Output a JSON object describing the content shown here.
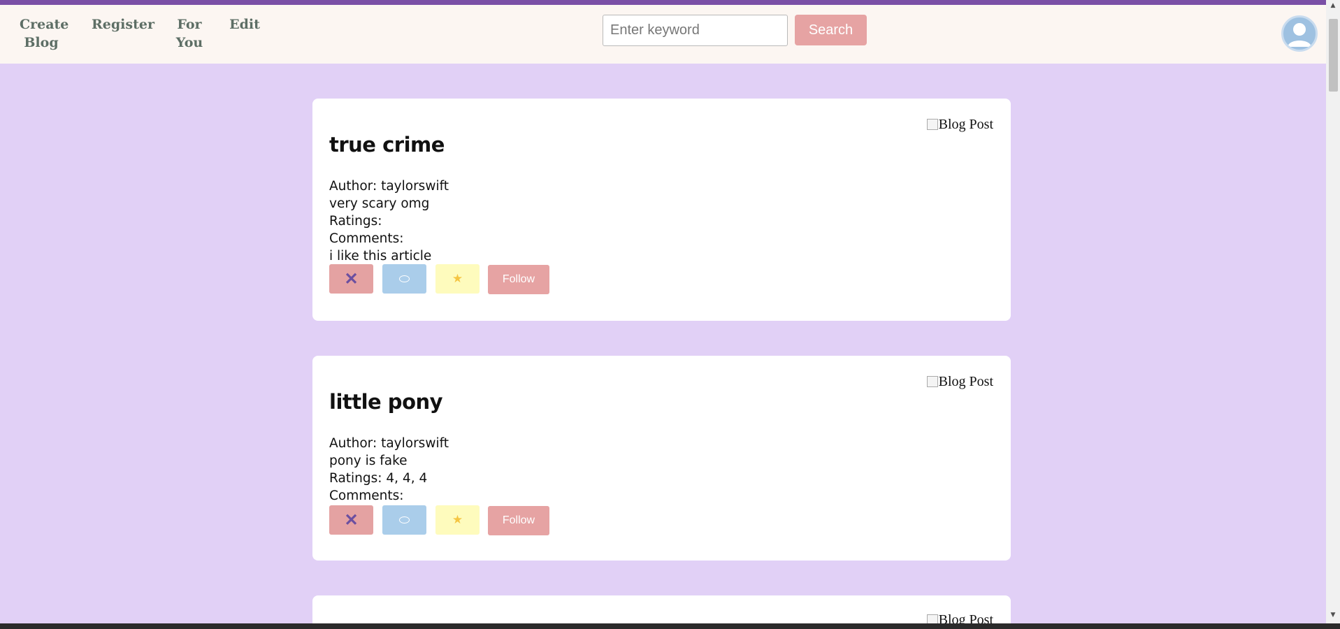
{
  "nav": {
    "create_blog": "Create Blog",
    "register": "Register",
    "for_you": "For You",
    "edit": "Edit"
  },
  "search": {
    "placeholder": "Enter keyword",
    "button_label": "Search"
  },
  "icons": {
    "close": "close-icon",
    "comment": "comment-icon",
    "star": "star-icon",
    "avatar": "user-avatar-icon"
  },
  "colors": {
    "page_bg": "#e1d0f6",
    "top_bar": "#7a4fa6",
    "nav_bg": "#fcf6f2",
    "search_button": "#e6a3a3",
    "close_button": "#e4a2a2",
    "comment_button": "#aacdea",
    "rate_button": "#fefbbd"
  },
  "posts": [
    {
      "title": "true crime",
      "image_alt": "Blog Post",
      "author": "Author: taylorswift",
      "body": "very scary omg",
      "ratings": "Ratings:",
      "comments_label": "Comments:",
      "comments": [
        "i like this article"
      ],
      "follow_label": "Follow"
    },
    {
      "title": "little pony",
      "image_alt": "Blog Post",
      "author": "Author: taylorswift",
      "body": "pony is fake",
      "ratings": "Ratings: 4, 4, 4",
      "comments_label": "Comments:",
      "comments": [],
      "follow_label": "Follow"
    },
    {
      "image_alt": "Blog Post"
    }
  ]
}
